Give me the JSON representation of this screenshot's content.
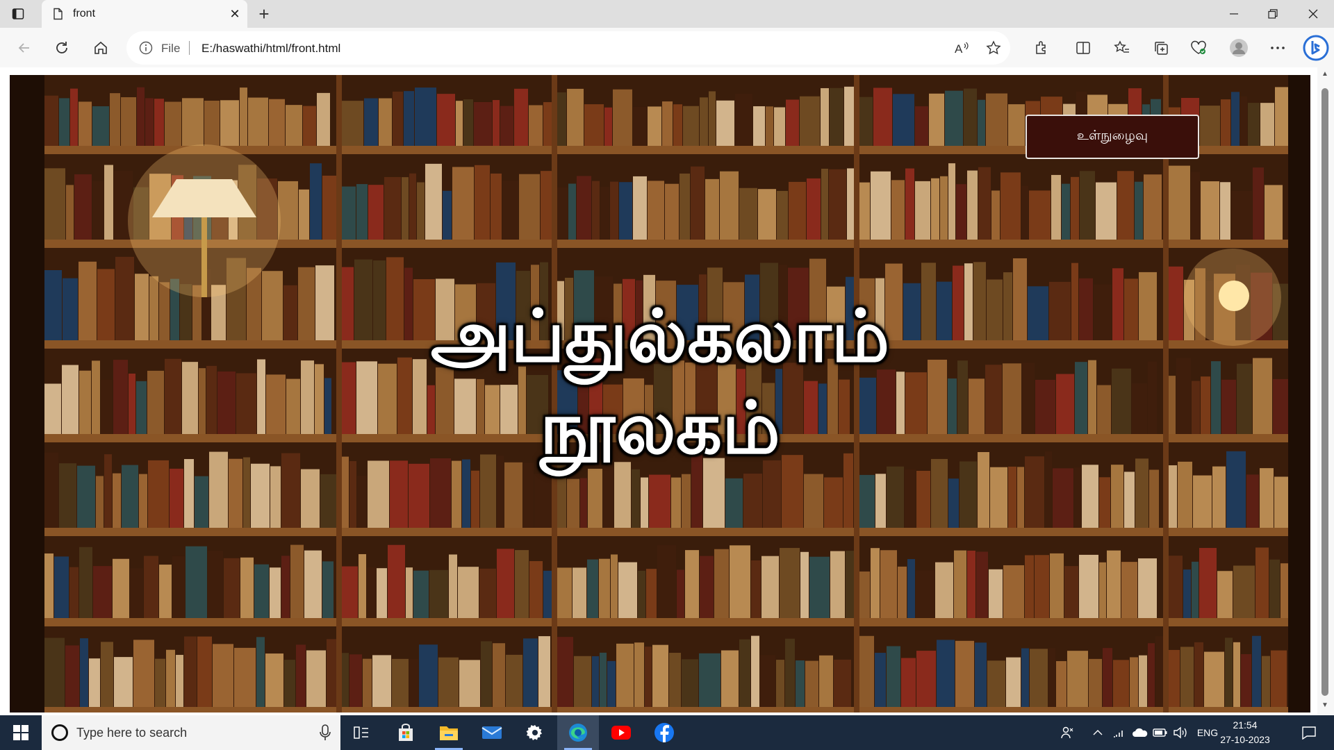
{
  "browser": {
    "tab_title": "front",
    "address_prefix": "File",
    "url": "E:/haswathi/html/front.html"
  },
  "page": {
    "login_label": "உள்நுழைவு",
    "title_line1": "அப்துல்கலாம்",
    "title_line2": "நூலகம்"
  },
  "taskbar": {
    "search_placeholder": "Type here to search",
    "language": "ENG",
    "time": "21:54",
    "date": "27-10-2023",
    "apps": [
      "task-view",
      "microsoft-store",
      "file-explorer",
      "mail",
      "settings",
      "edge",
      "youtube",
      "facebook"
    ]
  },
  "colors": {
    "login_bg": "#3a0f0a",
    "taskbar_bg": "#1b2a3e",
    "shelf_wood": "#6b3a17"
  }
}
